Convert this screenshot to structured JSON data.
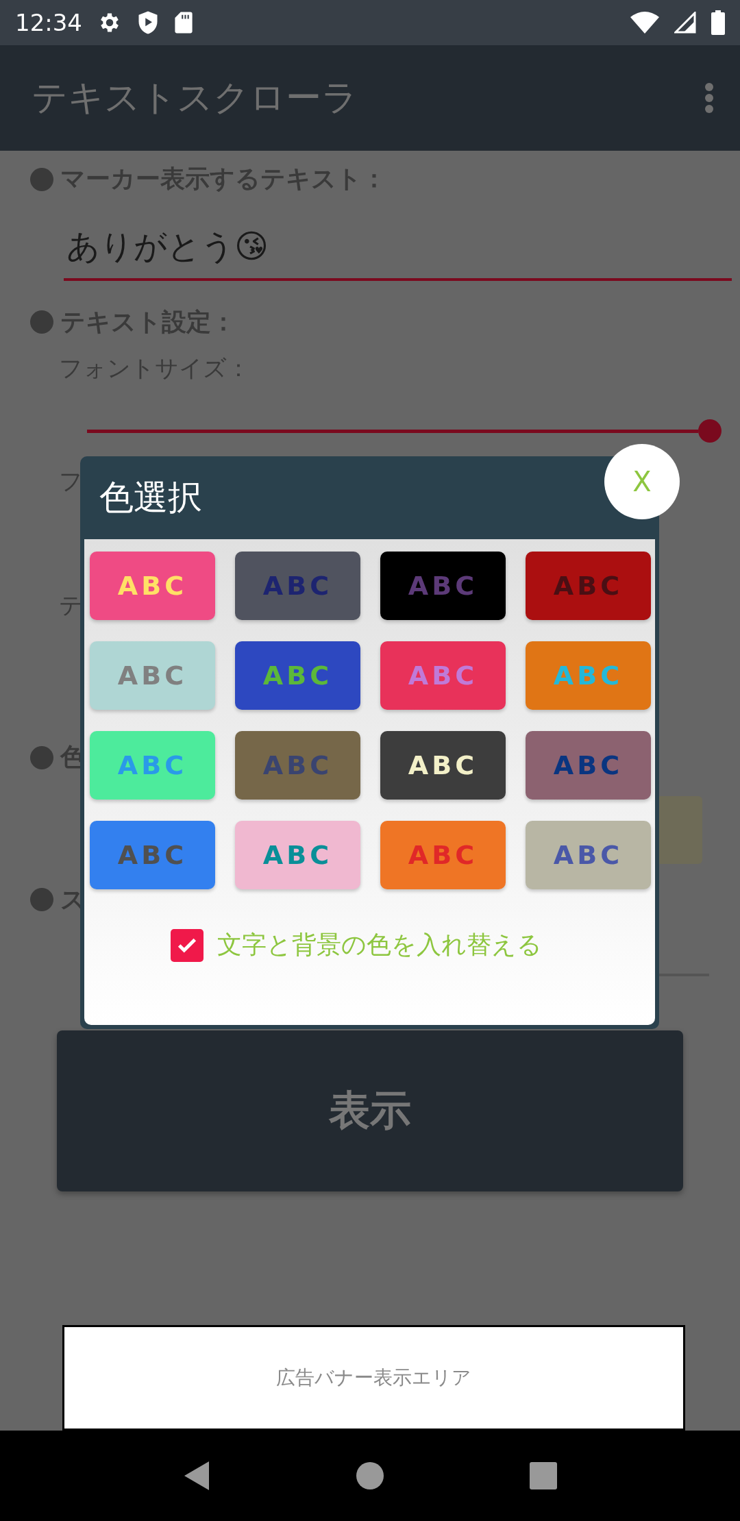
{
  "status_bar": {
    "time": "12:34"
  },
  "app_bar": {
    "title": "テキストスクローラ"
  },
  "marker_text": {
    "label": "マーカー表示するテキスト：",
    "value": "ありがとう😘"
  },
  "text_settings": {
    "label": "テキスト設定：",
    "font_size_label": "フォントサイズ：",
    "font_size_slider": {
      "level": 1
    },
    "partial_label_1": "フ",
    "partial_label_2": "テ"
  },
  "color_section": {
    "label": "色"
  },
  "section_4": {
    "label": "ス"
  },
  "show_button": "表示",
  "ad_banner": "広告バナー表示エリア",
  "dialog": {
    "title": "色選択",
    "close": "X",
    "swatches": [
      {
        "color": "#ef4b84",
        "label": {
          "text": "ABC",
          "color": "#ffe066"
        }
      },
      {
        "color": "#50535f",
        "label": {
          "text": "ABC",
          "color": "#1d2470"
        }
      },
      {
        "color": "#000000",
        "label": {
          "text": "ABC",
          "color": "#5c3a78"
        }
      },
      {
        "color": "#ab0f10",
        "label": {
          "text": "ABC",
          "color": "#4a0f14"
        }
      },
      {
        "color": "#afd6d4",
        "label": {
          "text": "ABC",
          "color": "#808080"
        }
      },
      {
        "color": "#2d48c0",
        "label": {
          "text": "ABC",
          "color": "#5cb83a"
        }
      },
      {
        "color": "#e8325a",
        "label": {
          "text": "ABC",
          "color": "#c07ad8"
        }
      },
      {
        "color": "#e07515",
        "label": {
          "text": "ABC",
          "color": "#25b8d8"
        }
      },
      {
        "color": "#4deb9c",
        "label": {
          "text": "ABC",
          "color": "#2a9ae8"
        }
      },
      {
        "color": "#766749",
        "label": {
          "text": "ABC",
          "color": "#3a4470"
        }
      },
      {
        "color": "#3d3d3d",
        "label": {
          "text": "ABC",
          "color": "#f3f0c8"
        }
      },
      {
        "color": "#8c6270",
        "label": {
          "text": "ABC",
          "color": "#0a3580"
        }
      },
      {
        "color": "#3380ef",
        "label": {
          "text": "ABC",
          "color": "#505050"
        }
      },
      {
        "color": "#f0b8d0",
        "label": {
          "text": "ABC",
          "color": "#0a8f98"
        }
      },
      {
        "color": "#ef7525",
        "label": {
          "text": "ABC",
          "color": "#e02828"
        }
      },
      {
        "color": "#b8b6a4",
        "label": {
          "text": "ABC",
          "color": "#4a58a8"
        }
      }
    ],
    "swap_checkbox": {
      "label": "文字と背景の色を入れ替える",
      "checked": true
    }
  }
}
